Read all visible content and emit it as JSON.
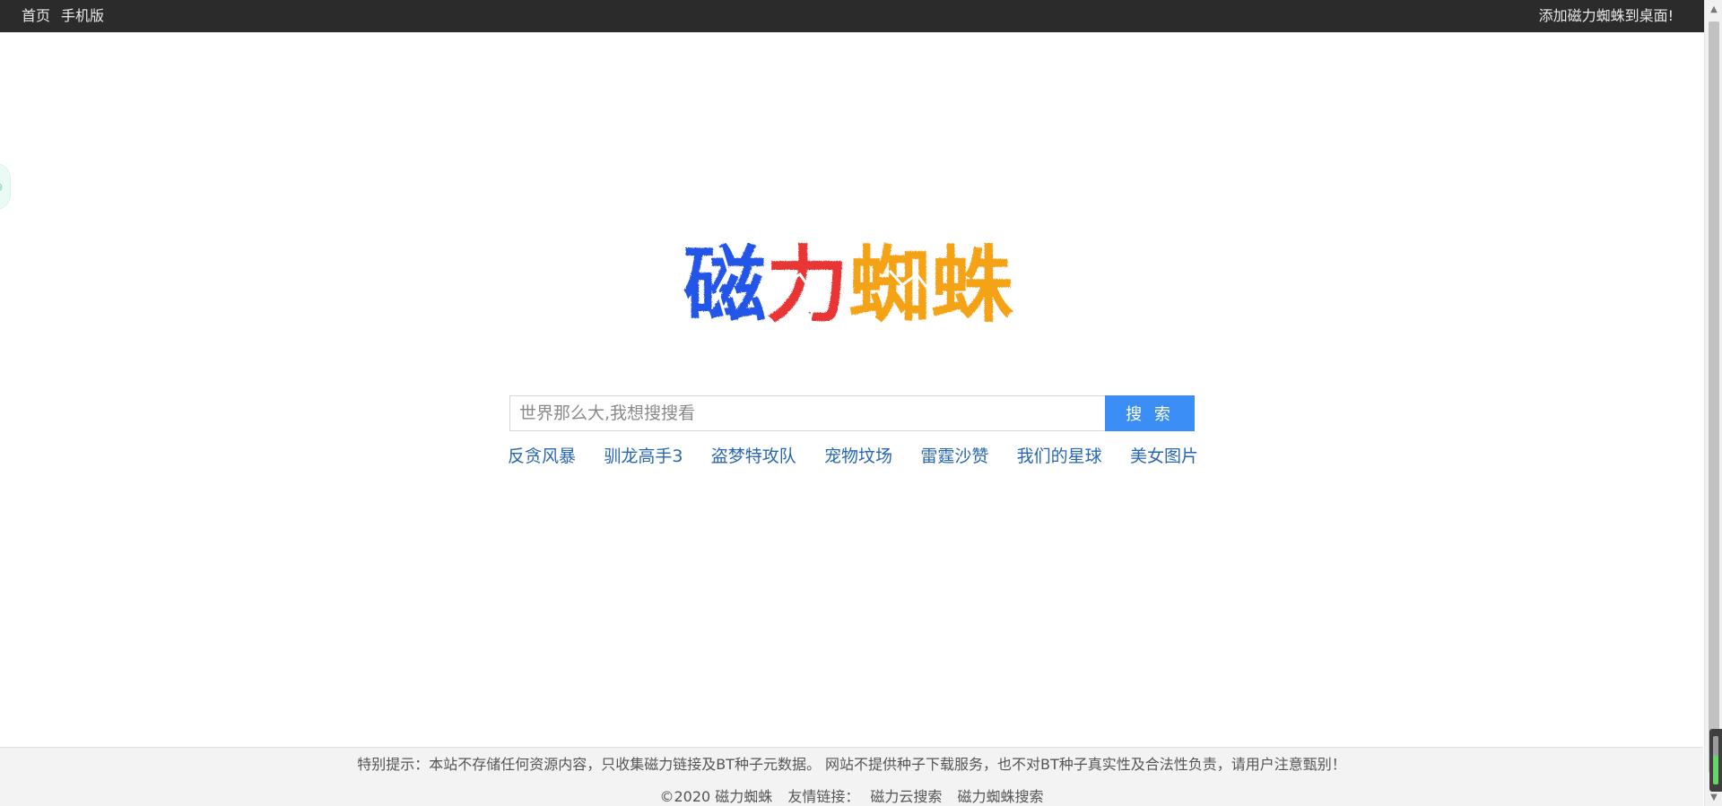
{
  "topbar": {
    "nav": [
      {
        "label": "首页"
      },
      {
        "label": "手机版"
      }
    ],
    "add_desktop": "添加磁力蜘蛛到桌面!"
  },
  "logo": {
    "chars": [
      "磁",
      "力",
      "蜘",
      "蛛"
    ],
    "colors": [
      "#2054e8",
      "#ea3535",
      "#f5a316",
      "#f5a316"
    ]
  },
  "search": {
    "placeholder": "世界那么大,我想搜搜看",
    "value": "",
    "button_label": "搜 索"
  },
  "hot_words": [
    "反贪风暴",
    "驯龙高手3",
    "盗梦特攻队",
    "宠物坟场",
    "雷霆沙赞",
    "我们的星球",
    "美女图片"
  ],
  "footer": {
    "notice": "特别提示：本站不存储任何资源内容，只收集磁力链接及BT种子元数据。 网站不提供种子下载服务，也不对BT种子真实性及合法性负责，请用户注意甄别！",
    "copyright": "©2020 磁力蜘蛛",
    "friend_links_label": "友情链接：",
    "friend_links": [
      "磁力云搜索",
      "磁力蜘蛛搜索"
    ]
  }
}
